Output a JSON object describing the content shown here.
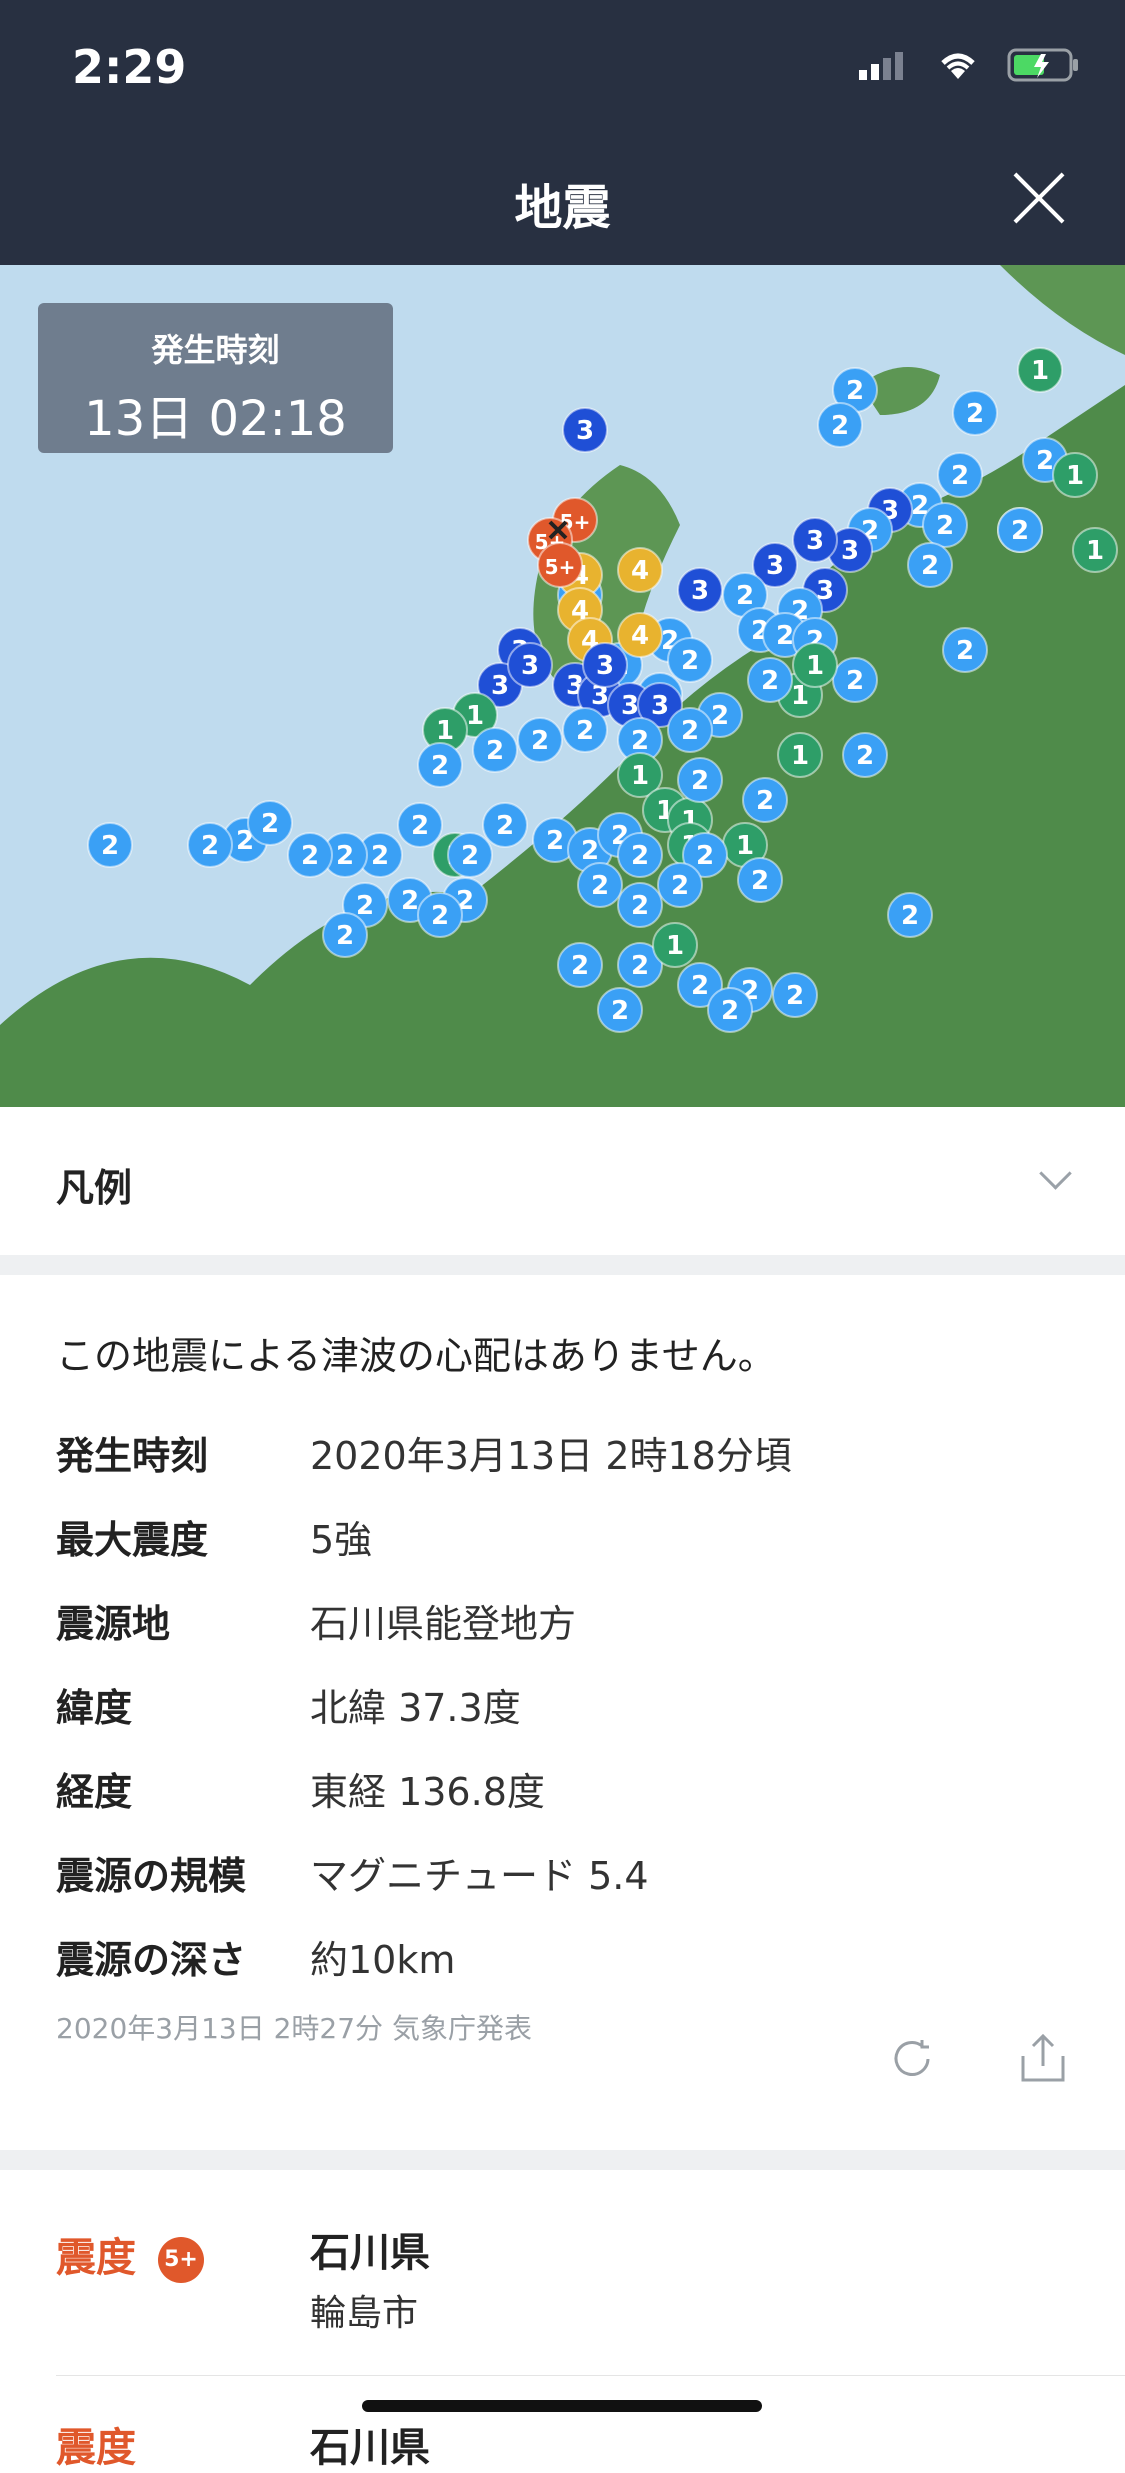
{
  "status": {
    "time": "2:29"
  },
  "header": {
    "title": "地震"
  },
  "map": {
    "time_label": "発生時刻",
    "time_value": "13日 02:18",
    "markers": [
      {
        "v": "3",
        "c": "#1f4fd6"
      },
      {
        "v": "2",
        "c": "#3aa0f5"
      },
      {
        "v": "1",
        "c": "#2e9e68"
      },
      {
        "v": "4",
        "c": "#e8b32f"
      },
      {
        "v": "5+",
        "c": "#e0582b"
      }
    ]
  },
  "legend": {
    "title": "凡例"
  },
  "info": {
    "tsunami": "この地震による津波の心配はありません。",
    "rows": [
      {
        "k": "発生時刻",
        "v": "2020年3月13日 2時18分頃"
      },
      {
        "k": "最大震度",
        "v": "5強"
      },
      {
        "k": "震源地",
        "v": "石川県能登地方"
      },
      {
        "k": "緯度",
        "v": "北緯 37.3度"
      },
      {
        "k": "経度",
        "v": "東経 136.8度"
      },
      {
        "k": "震源の規模",
        "v": "マグニチュード 5.4"
      },
      {
        "k": "震源の深さ",
        "v": "約10km"
      }
    ],
    "published": "2020年3月13日 2時27分 気象庁発表"
  },
  "intensity": {
    "label": "震度",
    "badge": "5+",
    "prefecture": "石川県",
    "city": "輪島市",
    "next_label": "震度",
    "next_prefecture": "石川県"
  }
}
